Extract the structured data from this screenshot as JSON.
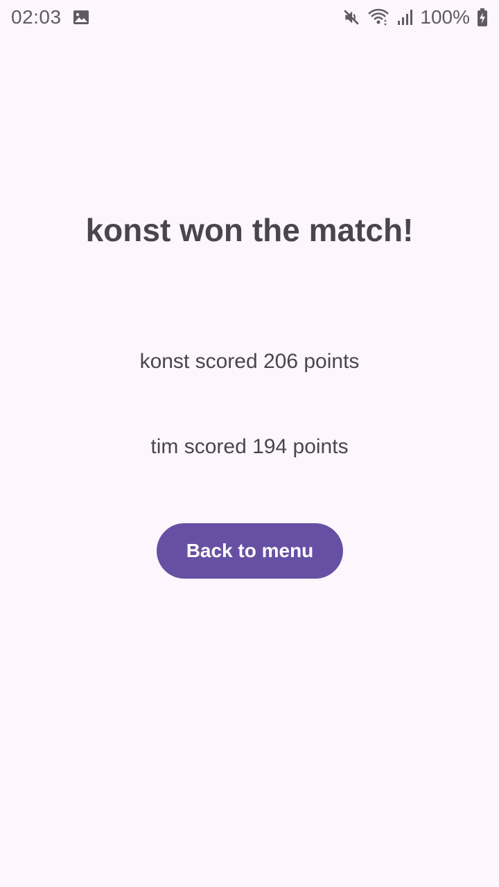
{
  "status_bar": {
    "time": "02:03",
    "battery": "100%",
    "icons": [
      "image-icon",
      "mute-icon",
      "wifi-icon",
      "signal-icon",
      "battery-charging-icon"
    ]
  },
  "result": {
    "title": "konst won the match!",
    "scores": [
      "konst scored 206 points",
      "tim scored 194 points"
    ]
  },
  "actions": {
    "back_label": "Back to menu"
  },
  "colors": {
    "background": "#fdf7fd",
    "text": "#49454f",
    "button": "#6750a4",
    "button_text": "#ffffff"
  }
}
